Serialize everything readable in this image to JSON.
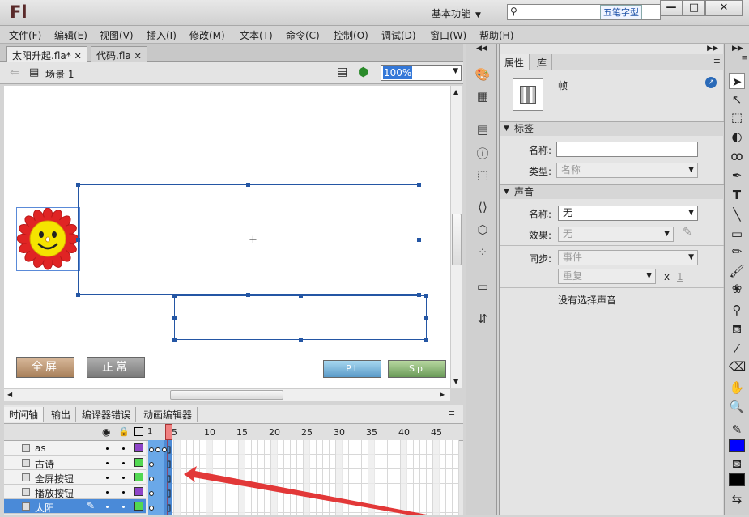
{
  "app": {
    "logo": "Fl",
    "workspace": "基本功能",
    "ime_label": "五笔字型"
  },
  "window_controls": {
    "minimize": "—",
    "maximize": "□",
    "close": "✕"
  },
  "menu": [
    "文件(F)",
    "编辑(E)",
    "视图(V)",
    "插入(I)",
    "修改(M)",
    "文本(T)",
    "命令(C)",
    "控制(O)",
    "调试(D)",
    "窗口(W)",
    "帮助(H)"
  ],
  "doc_tabs": [
    {
      "label": "太阳升起.fla*",
      "active": true
    },
    {
      "label": "代码.fla",
      "active": false
    }
  ],
  "scene": {
    "label": "场景 1"
  },
  "zoom": "100%",
  "stage_buttons": {
    "fullscreen": "全屏",
    "normal": "正常",
    "play": "Pl",
    "stop": "Sp"
  },
  "bottom_tabs": [
    "时间轴",
    "输出",
    "编译器错误",
    "动画编辑器"
  ],
  "ruler": [
    "1",
    "5",
    "10",
    "15",
    "20",
    "25",
    "30",
    "35",
    "40",
    "45"
  ],
  "layers": [
    {
      "name": "as",
      "color": "#8e44c8"
    },
    {
      "name": "古诗",
      "color": "#52d852"
    },
    {
      "name": "全屏按钮",
      "color": "#52d852"
    },
    {
      "name": "播放按钮",
      "color": "#8e44c8"
    },
    {
      "name": "太阳",
      "color": "#52d852"
    }
  ],
  "properties": {
    "tabs": [
      "属性",
      "库"
    ],
    "type_label": "帧",
    "label_section": "标签",
    "name_label": "名称:",
    "type_field_label": "类型:",
    "type_value": "名称",
    "sound_section": "声音",
    "sound_name_label": "名称:",
    "sound_name_value": "无",
    "effect_label": "效果:",
    "effect_value": "无",
    "sync_label": "同步:",
    "sync_value": "事件",
    "repeat_value": "重复",
    "repeat_x": "x",
    "repeat_count": "1",
    "no_sound": "没有选择声音"
  }
}
